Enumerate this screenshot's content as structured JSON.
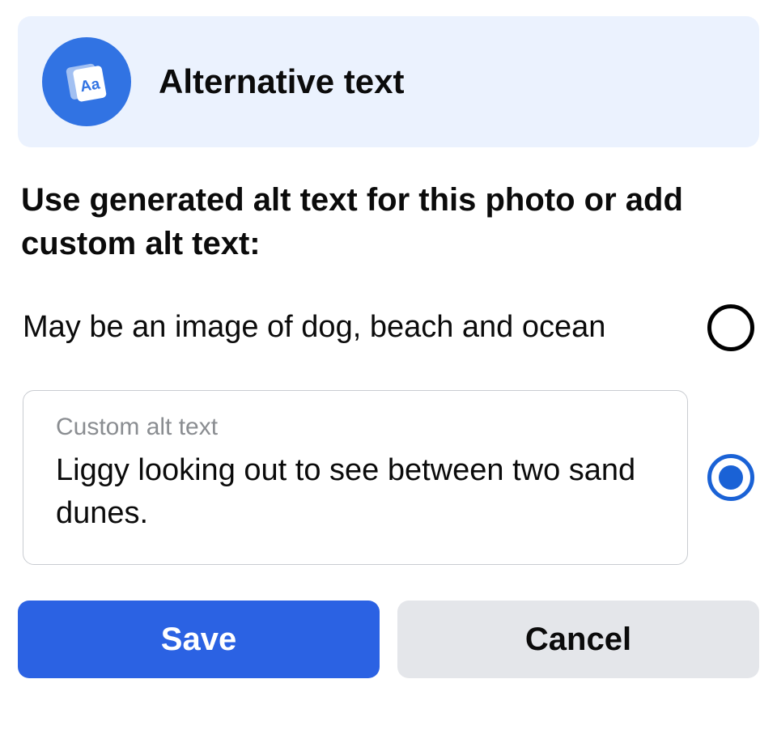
{
  "header": {
    "title": "Alternative text",
    "icon": "cards-aa-icon"
  },
  "instruction": "Use generated alt text for this photo or add custom alt text:",
  "options": {
    "generated": {
      "text": "May be an image of dog, beach and ocean",
      "selected": false
    },
    "custom": {
      "label": "Custom alt text",
      "value": "Liggy looking out to see between two sand dunes.",
      "selected": true
    }
  },
  "buttons": {
    "save": "Save",
    "cancel": "Cancel"
  },
  "colors": {
    "accent": "#2b62e3",
    "banner_bg": "#ebf2fe",
    "secondary_btn": "#e4e6ea"
  }
}
